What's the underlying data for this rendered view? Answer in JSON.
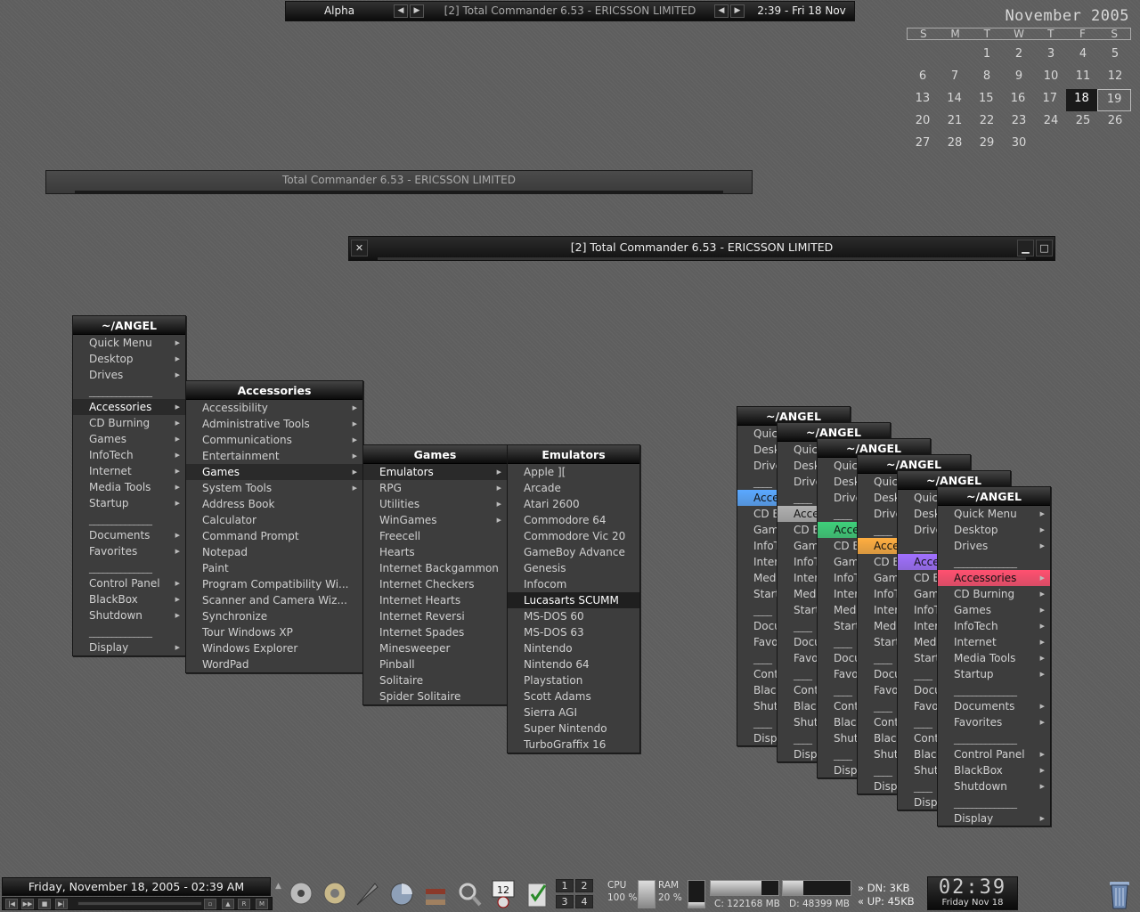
{
  "topbar": {
    "workspace": "Alpha",
    "task_title": "[2] Total Commander 6.53 - ERICSSON LIMITED",
    "clock": "2:39 - Fri 18 Nov"
  },
  "calendar": {
    "title": "November 2005",
    "weekdays": [
      "S",
      "M",
      "T",
      "W",
      "T",
      "F",
      "S"
    ],
    "weeks": [
      [
        "",
        "",
        "1",
        "2",
        "3",
        "4",
        "5"
      ],
      [
        "6",
        "7",
        "8",
        "9",
        "10",
        "11",
        "12"
      ],
      [
        "13",
        "14",
        "15",
        "16",
        "17",
        "18",
        "19"
      ],
      [
        "20",
        "21",
        "22",
        "23",
        "24",
        "25",
        "26"
      ],
      [
        "27",
        "28",
        "29",
        "30",
        "",
        "",
        ""
      ]
    ],
    "today": "18",
    "selected": "19"
  },
  "window_back": {
    "title": "Total Commander 6.53 - ERICSSON LIMITED"
  },
  "window_front": {
    "title": "[2] Total Commander 6.53 - ERICSSON LIMITED",
    "close": "✕",
    "minimize": "▁",
    "maximize": "□"
  },
  "root_menu": {
    "title": "~/ANGEL",
    "items": [
      {
        "label": "Quick Menu",
        "arrow": true
      },
      {
        "label": "Desktop",
        "arrow": true
      },
      {
        "label": "Drives",
        "arrow": true
      },
      {
        "label": "______________",
        "sep": true
      },
      {
        "label": "Accessories",
        "arrow": true,
        "active": true
      },
      {
        "label": "CD Burning",
        "arrow": true
      },
      {
        "label": "Games",
        "arrow": true
      },
      {
        "label": "InfoTech",
        "arrow": true
      },
      {
        "label": "Internet",
        "arrow": true
      },
      {
        "label": "Media Tools",
        "arrow": true
      },
      {
        "label": "Startup",
        "arrow": true
      },
      {
        "label": "______________",
        "sep": true
      },
      {
        "label": "Documents",
        "arrow": true
      },
      {
        "label": "Favorites",
        "arrow": true
      },
      {
        "label": "______________",
        "sep": true
      },
      {
        "label": "Control Panel",
        "arrow": true
      },
      {
        "label": "BlackBox",
        "arrow": true
      },
      {
        "label": "Shutdown",
        "arrow": true
      },
      {
        "label": "______________",
        "sep": true
      },
      {
        "label": "Display",
        "arrow": true
      }
    ]
  },
  "accessories_menu": {
    "title": "Accessories",
    "items": [
      {
        "label": "Accessibility",
        "arrow": true
      },
      {
        "label": "Administrative Tools",
        "arrow": true
      },
      {
        "label": "Communications",
        "arrow": true
      },
      {
        "label": "Entertainment",
        "arrow": true
      },
      {
        "label": "Games",
        "arrow": true,
        "active": true
      },
      {
        "label": "System Tools",
        "arrow": true
      },
      {
        "label": "Address Book"
      },
      {
        "label": "Calculator"
      },
      {
        "label": "Command Prompt"
      },
      {
        "label": "Notepad"
      },
      {
        "label": "Paint"
      },
      {
        "label": "Program Compatibility Wi..."
      },
      {
        "label": "Scanner and Camera Wiz..."
      },
      {
        "label": "Synchronize"
      },
      {
        "label": "Tour Windows XP"
      },
      {
        "label": "Windows Explorer"
      },
      {
        "label": "WordPad"
      }
    ]
  },
  "games_menu": {
    "title": "Games",
    "items": [
      {
        "label": "Emulators",
        "arrow": true,
        "active": true
      },
      {
        "label": "RPG",
        "arrow": true
      },
      {
        "label": "Utilities",
        "arrow": true
      },
      {
        "label": "WinGames",
        "arrow": true
      },
      {
        "label": "Freecell"
      },
      {
        "label": "Hearts"
      },
      {
        "label": "Internet Backgammon"
      },
      {
        "label": "Internet Checkers"
      },
      {
        "label": "Internet Hearts"
      },
      {
        "label": "Internet Reversi"
      },
      {
        "label": "Internet Spades"
      },
      {
        "label": "Minesweeper"
      },
      {
        "label": "Pinball"
      },
      {
        "label": "Solitaire"
      },
      {
        "label": "Spider Solitaire"
      }
    ]
  },
  "emulators_menu": {
    "title": "Emulators",
    "items": [
      {
        "label": "Apple ]["
      },
      {
        "label": "Arcade"
      },
      {
        "label": "Atari 2600"
      },
      {
        "label": "Commodore 64"
      },
      {
        "label": "Commodore Vic 20"
      },
      {
        "label": "GameBoy Advance"
      },
      {
        "label": "Genesis"
      },
      {
        "label": "Infocom"
      },
      {
        "label": "Lucasarts SCUMM",
        "active": true
      },
      {
        "label": "MS-DOS 60"
      },
      {
        "label": "MS-DOS 63"
      },
      {
        "label": "Nintendo"
      },
      {
        "label": "Nintendo 64"
      },
      {
        "label": "Playstation"
      },
      {
        "label": "Scott Adams"
      },
      {
        "label": "Sierra AGI"
      },
      {
        "label": "Super Nintendo"
      },
      {
        "label": "TurboGraffix 16"
      }
    ]
  },
  "stack_colors": [
    "#5aa8ff",
    "#b0b0b0",
    "#3ed07a",
    "#ffae40",
    "#a070ff",
    "#ff5070"
  ],
  "stack_partial_labels": [
    "Quic",
    "Desk",
    "Drive",
    "____",
    "Acce",
    "CD B",
    "Gam",
    "InfoT",
    "Inter",
    "Med",
    "Start",
    "____",
    "Docu",
    "Favo",
    "____",
    "Cont",
    "Black",
    "Shutd",
    "____",
    "Disp"
  ],
  "taskbar": {
    "date": "Friday, November 18, 2005 - 02:39 AM",
    "media_buttons": [
      "|◀",
      "▶▶",
      "■",
      "▶|",
      "▫",
      "▲",
      "R",
      "M"
    ],
    "desks": [
      "1",
      "2",
      "3",
      "4"
    ],
    "cpu_label": "CPU",
    "cpu_value": "100 %",
    "cpu_level": 1.0,
    "ram_label": "RAM",
    "ram_value": "20 %",
    "ram_level": 0.2,
    "drive_c": "C: 122168 MB",
    "drive_d": "D: 48399 MB",
    "drive_c_level": 0.75,
    "drive_d_level": 0.3,
    "net_dn": "» DN: 3KB",
    "net_up": "« UP: 45KB",
    "clock_big": "02:39",
    "clock_date": "Friday Nov 18"
  }
}
